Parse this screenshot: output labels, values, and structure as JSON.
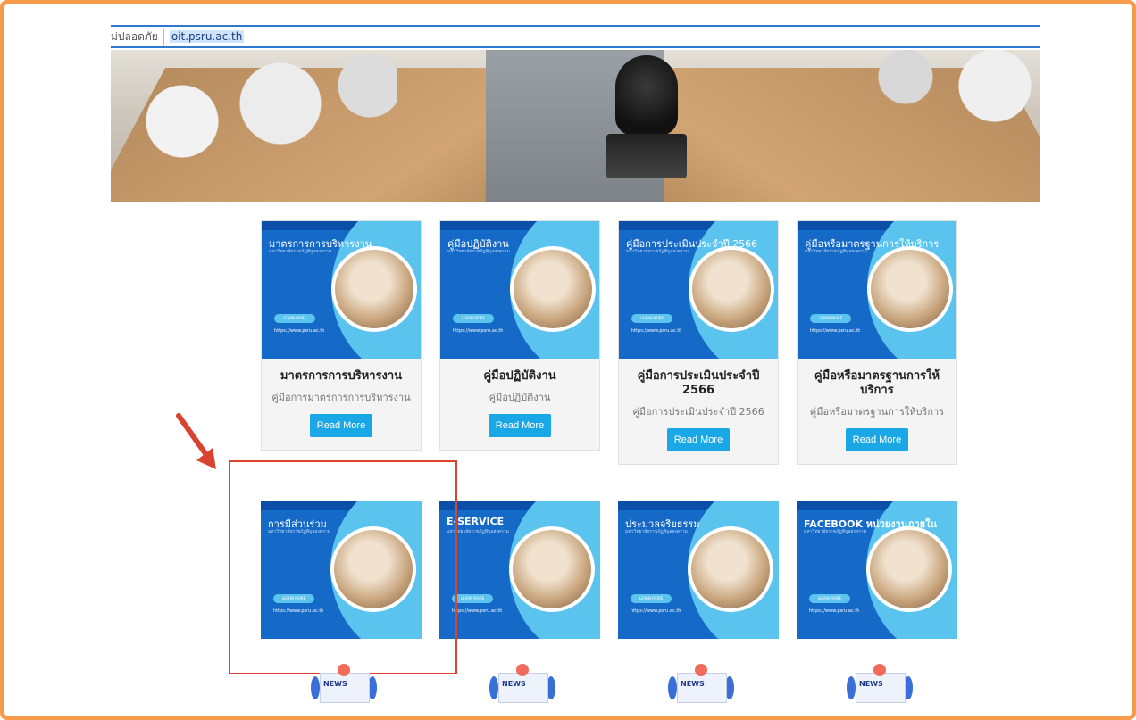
{
  "browser": {
    "security_label": "ไม่ปลอดภัย",
    "security_visible": "ม่ปลอดภัย",
    "url": "oit.psru.ac.th"
  },
  "cards_row1": [
    {
      "image_title": "มาตรการการบริหารงาน",
      "image_sub": "มหาวิทยาลัยราชภัฏพิบูลสงคราม",
      "name": "มาตรการการบริหารงาน",
      "desc": "คู่มือการมาตรการการบริหารงาน",
      "button": "Read More"
    },
    {
      "image_title": "คู่มือปฏิบัติงาน",
      "image_sub": "มหาวิทยาลัยราชภัฏพิบูลสงคราม",
      "name": "คู่มือปฏิบัติงาน",
      "desc": "คู่มือปฏิบัติงาน",
      "button": "Read More"
    },
    {
      "image_title": "คู่มือการประเมินประจำปี 2566",
      "image_sub": "มหาวิทยาลัยราชภัฏพิบูลสงคราม",
      "name": "คู่มือการประเมินประจำปี 2566",
      "desc": "คู่มือการประเมินประจำปี 2566",
      "button": "Read More"
    },
    {
      "image_title": "คู่มือหรือมาตรฐานการให้บริการ",
      "image_sub": "มหาวิทยาลัยราชภัฏพิบูลสงคราม",
      "name": "คู่มือหรือมาตรฐานการให้บริการ",
      "desc": "คู่มือหรือมาตรฐานการให้บริการ",
      "button": "Read More"
    }
  ],
  "cards_row2": [
    {
      "image_title": "การมีส่วนร่วม",
      "image_sub": "มหาวิทยาลัยราชภัฏพิบูลสงคราม"
    },
    {
      "image_title": "E-SERVICE",
      "image_sub": "มหาวิทยาลัยราชภัฏพิบูลสงคราม"
    },
    {
      "image_title": "ประมวลจริยธรรม",
      "image_sub": "มหาวิทยาลัยราชภัฏพิบูลสงคราม"
    },
    {
      "image_title": "FACEBOOK หน่วยงานภายใน",
      "image_sub": "มหาวิทยาลัยราชภัฏพิบูลสงคราม"
    }
  ],
  "thumb_common": {
    "pill": "LEARN MORE",
    "site": "https://www.psru.ac.th"
  },
  "news_label": "NEWS",
  "colors": {
    "frame": "#f59b4b",
    "card_blue": "#1569c7",
    "accent": "#5bc4ee",
    "button": "#19a7e6",
    "highlight": "#d9432f"
  }
}
